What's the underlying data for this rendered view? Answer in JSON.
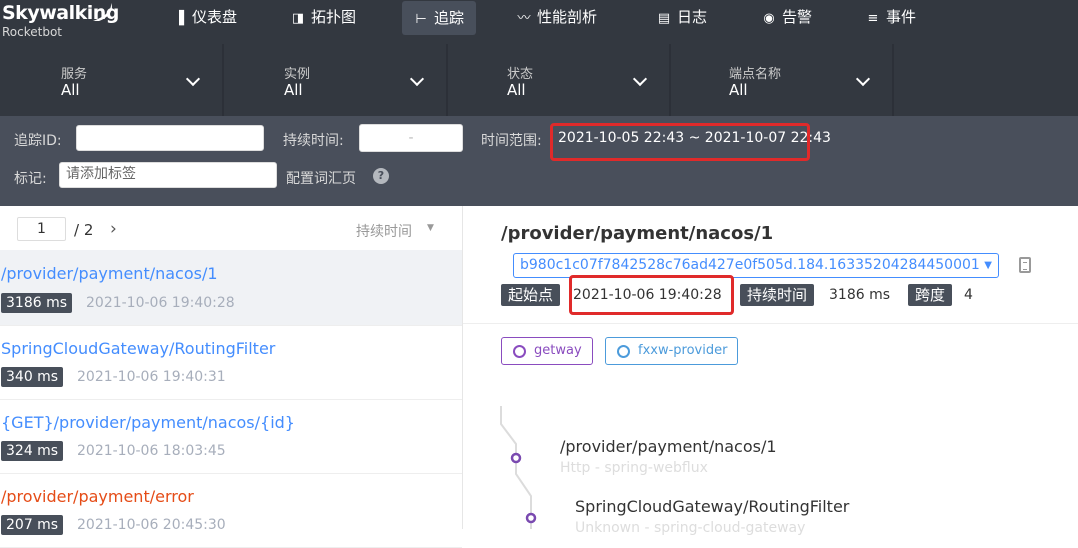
{
  "logo": {
    "title": "Skywalking",
    "subtitle": "Rocketbot"
  },
  "nav": [
    {
      "label": "仪表盘",
      "icon": "dashboard-icon",
      "glyph": "▐"
    },
    {
      "label": "拓扑图",
      "icon": "topology-icon",
      "glyph": "◨"
    },
    {
      "label": "追踪",
      "icon": "trace-icon",
      "glyph": "⊢"
    },
    {
      "label": "性能剖析",
      "icon": "profile-icon",
      "glyph": "〰"
    },
    {
      "label": "日志",
      "icon": "log-icon",
      "glyph": "▤"
    },
    {
      "label": "告警",
      "icon": "alarm-icon",
      "glyph": "◉"
    },
    {
      "label": "事件",
      "icon": "event-icon",
      "glyph": "≡"
    }
  ],
  "active_nav": "追踪",
  "filters": [
    {
      "label": "服务",
      "value": "All"
    },
    {
      "label": "实例",
      "value": "All"
    },
    {
      "label": "状态",
      "value": "All"
    },
    {
      "label": "端点名称",
      "value": "All"
    }
  ],
  "search": {
    "trace_id_label": "追踪ID:",
    "trace_id_value": "",
    "duration_label": "持续时间:",
    "duration_value": "-",
    "time_range_label": "时间范围:",
    "time_range_value": "2021-10-05 22:43 ~ 2021-10-07 22:43",
    "tag_label": "标记:",
    "tag_placeholder": "请添加标签",
    "config_label": "配置词汇页",
    "help_glyph": "?"
  },
  "pager": {
    "current": "1",
    "total": "/ 2",
    "sort_label": "持续时间"
  },
  "traces": [
    {
      "name": "/provider/payment/nacos/1",
      "duration": "3186 ms",
      "time": "2021-10-06 19:40:28",
      "error": false,
      "selected": true
    },
    {
      "name": "SpringCloudGateway/RoutingFilter",
      "duration": "340 ms",
      "time": "2021-10-06 19:40:31",
      "error": false,
      "selected": false
    },
    {
      "name": "{GET}/provider/payment/nacos/{id}",
      "duration": "324 ms",
      "time": "2021-10-06 18:03:45",
      "error": false,
      "selected": false
    },
    {
      "name": "/provider/payment/error",
      "duration": "207 ms",
      "time": "2021-10-06 20:45:30",
      "error": true,
      "selected": false
    }
  ],
  "detail": {
    "title": "/provider/payment/nacos/1",
    "trace_id": "b980c1c07f7842528c76ad427e0f505d.184.16335204284450001",
    "start_label": "起始点",
    "start_value": "2021-10-06 19:40:28",
    "duration_label": "持续时间",
    "duration_value": "3186 ms",
    "span_label": "跨度",
    "span_value": "4",
    "services": [
      {
        "name": "getway",
        "color": "#8a4cbf"
      },
      {
        "name": "fxxw-provider",
        "color": "#4c9bdb"
      }
    ],
    "spans": [
      {
        "name": "/provider/payment/nacos/1",
        "sub": "Http - spring-webflux"
      },
      {
        "name": "SpringCloudGateway/RoutingFilter",
        "sub": "Unknown - spring-cloud-gateway"
      }
    ]
  },
  "colors": {
    "nav_bg": "#333840",
    "search_bg": "#494f5b",
    "link": "#448dfe",
    "error": "#e54c17",
    "highlight_box": "#e02a2a",
    "span_node": "#7a4ab0"
  }
}
